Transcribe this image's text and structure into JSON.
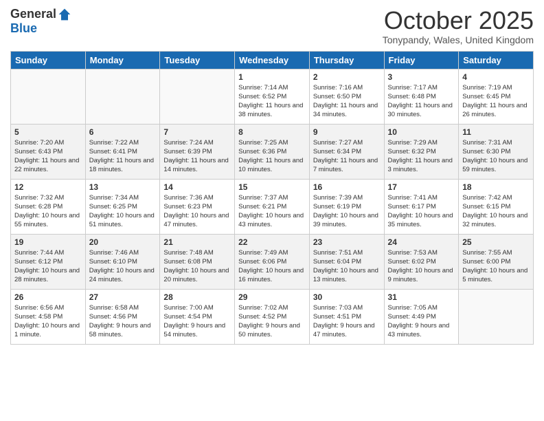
{
  "header": {
    "logo_general": "General",
    "logo_blue": "Blue",
    "month_title": "October 2025",
    "location": "Tonypandy, Wales, United Kingdom"
  },
  "weekdays": [
    "Sunday",
    "Monday",
    "Tuesday",
    "Wednesday",
    "Thursday",
    "Friday",
    "Saturday"
  ],
  "weeks": [
    [
      {
        "day": "",
        "sunrise": "",
        "sunset": "",
        "daylight": ""
      },
      {
        "day": "",
        "sunrise": "",
        "sunset": "",
        "daylight": ""
      },
      {
        "day": "",
        "sunrise": "",
        "sunset": "",
        "daylight": ""
      },
      {
        "day": "1",
        "sunrise": "Sunrise: 7:14 AM",
        "sunset": "Sunset: 6:52 PM",
        "daylight": "Daylight: 11 hours and 38 minutes."
      },
      {
        "day": "2",
        "sunrise": "Sunrise: 7:16 AM",
        "sunset": "Sunset: 6:50 PM",
        "daylight": "Daylight: 11 hours and 34 minutes."
      },
      {
        "day": "3",
        "sunrise": "Sunrise: 7:17 AM",
        "sunset": "Sunset: 6:48 PM",
        "daylight": "Daylight: 11 hours and 30 minutes."
      },
      {
        "day": "4",
        "sunrise": "Sunrise: 7:19 AM",
        "sunset": "Sunset: 6:45 PM",
        "daylight": "Daylight: 11 hours and 26 minutes."
      }
    ],
    [
      {
        "day": "5",
        "sunrise": "Sunrise: 7:20 AM",
        "sunset": "Sunset: 6:43 PM",
        "daylight": "Daylight: 11 hours and 22 minutes."
      },
      {
        "day": "6",
        "sunrise": "Sunrise: 7:22 AM",
        "sunset": "Sunset: 6:41 PM",
        "daylight": "Daylight: 11 hours and 18 minutes."
      },
      {
        "day": "7",
        "sunrise": "Sunrise: 7:24 AM",
        "sunset": "Sunset: 6:39 PM",
        "daylight": "Daylight: 11 hours and 14 minutes."
      },
      {
        "day": "8",
        "sunrise": "Sunrise: 7:25 AM",
        "sunset": "Sunset: 6:36 PM",
        "daylight": "Daylight: 11 hours and 10 minutes."
      },
      {
        "day": "9",
        "sunrise": "Sunrise: 7:27 AM",
        "sunset": "Sunset: 6:34 PM",
        "daylight": "Daylight: 11 hours and 7 minutes."
      },
      {
        "day": "10",
        "sunrise": "Sunrise: 7:29 AM",
        "sunset": "Sunset: 6:32 PM",
        "daylight": "Daylight: 11 hours and 3 minutes."
      },
      {
        "day": "11",
        "sunrise": "Sunrise: 7:31 AM",
        "sunset": "Sunset: 6:30 PM",
        "daylight": "Daylight: 10 hours and 59 minutes."
      }
    ],
    [
      {
        "day": "12",
        "sunrise": "Sunrise: 7:32 AM",
        "sunset": "Sunset: 6:28 PM",
        "daylight": "Daylight: 10 hours and 55 minutes."
      },
      {
        "day": "13",
        "sunrise": "Sunrise: 7:34 AM",
        "sunset": "Sunset: 6:25 PM",
        "daylight": "Daylight: 10 hours and 51 minutes."
      },
      {
        "day": "14",
        "sunrise": "Sunrise: 7:36 AM",
        "sunset": "Sunset: 6:23 PM",
        "daylight": "Daylight: 10 hours and 47 minutes."
      },
      {
        "day": "15",
        "sunrise": "Sunrise: 7:37 AM",
        "sunset": "Sunset: 6:21 PM",
        "daylight": "Daylight: 10 hours and 43 minutes."
      },
      {
        "day": "16",
        "sunrise": "Sunrise: 7:39 AM",
        "sunset": "Sunset: 6:19 PM",
        "daylight": "Daylight: 10 hours and 39 minutes."
      },
      {
        "day": "17",
        "sunrise": "Sunrise: 7:41 AM",
        "sunset": "Sunset: 6:17 PM",
        "daylight": "Daylight: 10 hours and 35 minutes."
      },
      {
        "day": "18",
        "sunrise": "Sunrise: 7:42 AM",
        "sunset": "Sunset: 6:15 PM",
        "daylight": "Daylight: 10 hours and 32 minutes."
      }
    ],
    [
      {
        "day": "19",
        "sunrise": "Sunrise: 7:44 AM",
        "sunset": "Sunset: 6:12 PM",
        "daylight": "Daylight: 10 hours and 28 minutes."
      },
      {
        "day": "20",
        "sunrise": "Sunrise: 7:46 AM",
        "sunset": "Sunset: 6:10 PM",
        "daylight": "Daylight: 10 hours and 24 minutes."
      },
      {
        "day": "21",
        "sunrise": "Sunrise: 7:48 AM",
        "sunset": "Sunset: 6:08 PM",
        "daylight": "Daylight: 10 hours and 20 minutes."
      },
      {
        "day": "22",
        "sunrise": "Sunrise: 7:49 AM",
        "sunset": "Sunset: 6:06 PM",
        "daylight": "Daylight: 10 hours and 16 minutes."
      },
      {
        "day": "23",
        "sunrise": "Sunrise: 7:51 AM",
        "sunset": "Sunset: 6:04 PM",
        "daylight": "Daylight: 10 hours and 13 minutes."
      },
      {
        "day": "24",
        "sunrise": "Sunrise: 7:53 AM",
        "sunset": "Sunset: 6:02 PM",
        "daylight": "Daylight: 10 hours and 9 minutes."
      },
      {
        "day": "25",
        "sunrise": "Sunrise: 7:55 AM",
        "sunset": "Sunset: 6:00 PM",
        "daylight": "Daylight: 10 hours and 5 minutes."
      }
    ],
    [
      {
        "day": "26",
        "sunrise": "Sunrise: 6:56 AM",
        "sunset": "Sunset: 4:58 PM",
        "daylight": "Daylight: 10 hours and 1 minute."
      },
      {
        "day": "27",
        "sunrise": "Sunrise: 6:58 AM",
        "sunset": "Sunset: 4:56 PM",
        "daylight": "Daylight: 9 hours and 58 minutes."
      },
      {
        "day": "28",
        "sunrise": "Sunrise: 7:00 AM",
        "sunset": "Sunset: 4:54 PM",
        "daylight": "Daylight: 9 hours and 54 minutes."
      },
      {
        "day": "29",
        "sunrise": "Sunrise: 7:02 AM",
        "sunset": "Sunset: 4:52 PM",
        "daylight": "Daylight: 9 hours and 50 minutes."
      },
      {
        "day": "30",
        "sunrise": "Sunrise: 7:03 AM",
        "sunset": "Sunset: 4:51 PM",
        "daylight": "Daylight: 9 hours and 47 minutes."
      },
      {
        "day": "31",
        "sunrise": "Sunrise: 7:05 AM",
        "sunset": "Sunset: 4:49 PM",
        "daylight": "Daylight: 9 hours and 43 minutes."
      },
      {
        "day": "",
        "sunrise": "",
        "sunset": "",
        "daylight": ""
      }
    ]
  ]
}
